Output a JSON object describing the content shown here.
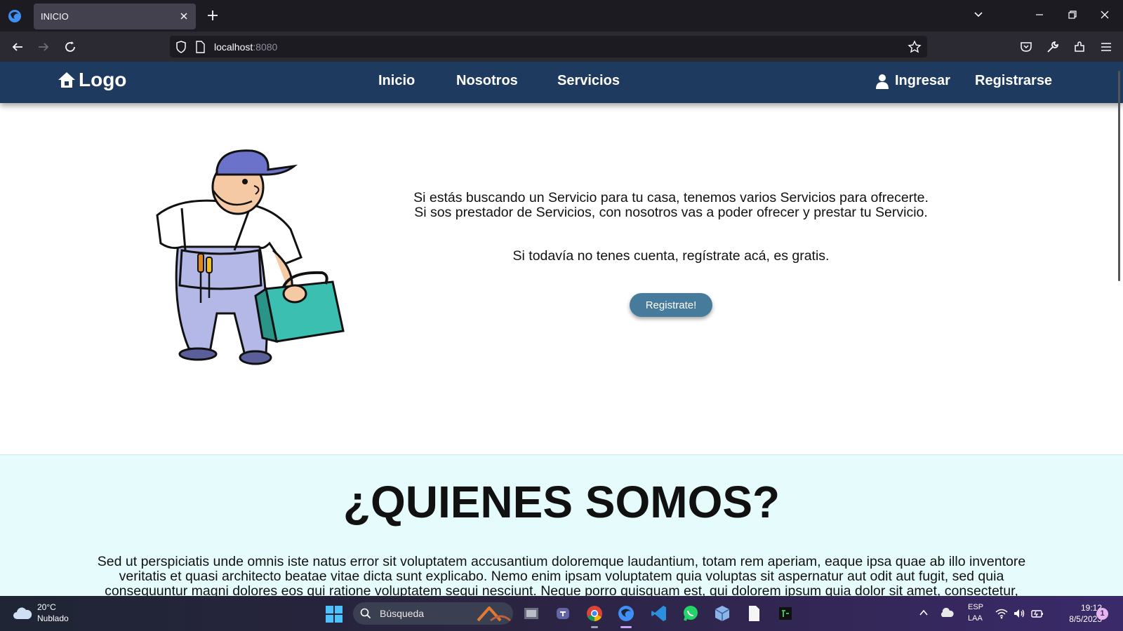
{
  "browser": {
    "tab_title": "INICIO",
    "url_host": "localhost",
    "url_port": ":8080"
  },
  "site": {
    "logo": "Logo",
    "nav": {
      "inicio": "Inicio",
      "nosotros": "Nosotros",
      "servicios": "Servicios",
      "ingresar": "Ingresar",
      "registrarse": "Registrarse"
    },
    "hero": {
      "line1": "Si estás buscando un Servicio para tu casa, tenemos varios Servicios para ofrecerte.",
      "line2": "Si sos prestador de Servicios, con nosotros vas a poder ofrecer y prestar tu Servicio.",
      "line3": "Si todavía no tenes cuenta, regístrate acá, es gratis.",
      "button": "Registrate!"
    },
    "quienes": {
      "title": "¿QUIENES SOMOS?",
      "text": "Sed ut perspiciatis unde omnis iste natus error sit voluptatem accusantium doloremque laudantium, totam rem aperiam, eaque ipsa quae ab illo inventore veritatis et quasi architecto beatae vitae dicta sunt explicabo. Nemo enim ipsam voluptatem quia voluptas sit aspernatur aut odit aut fugit, sed quia consequuntur magni dolores eos qui ratione voluptatem sequi nesciunt. Neque porro quisquam est, qui dolorem ipsum quia dolor sit amet, consectetur, adipisci"
    },
    "colors": {
      "header_bg": "#1f3a5f",
      "button_bg": "#467b9c",
      "section_bg": "#e6fcfc"
    }
  },
  "taskbar": {
    "weather_temp": "20°C",
    "weather_desc": "Nublado",
    "search_placeholder": "Búsqueda",
    "lang_top": "ESP",
    "lang_bottom": "LAA",
    "time": "19:12",
    "date": "8/5/2023",
    "notifications": "1",
    "apps": [
      "file-explorer-icon",
      "teams-icon",
      "chrome-icon",
      "firefox-icon",
      "vscode-icon",
      "whatsapp-icon",
      "virtualbox-icon",
      "notes-icon",
      "terminal-icon"
    ]
  }
}
